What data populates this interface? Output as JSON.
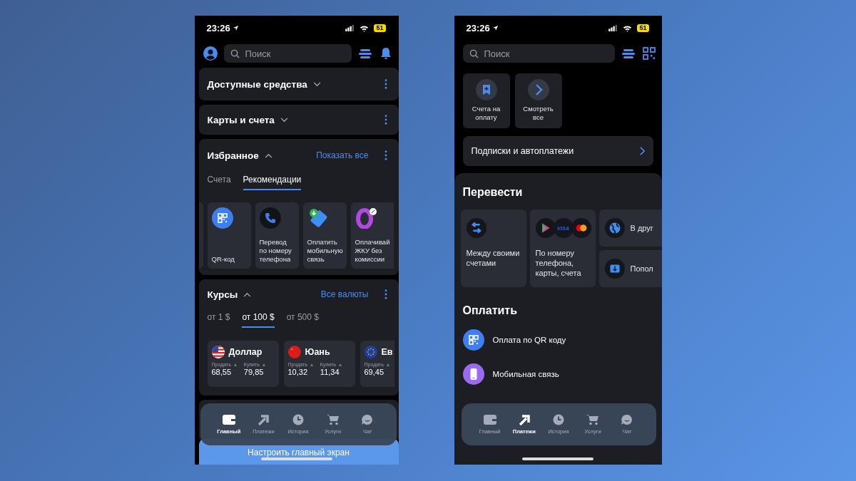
{
  "left_screen": {
    "status_bar": {
      "time": "23:26",
      "battery": "51"
    },
    "search": {
      "placeholder": "Поиск"
    },
    "sections": [
      {
        "title": "Доступные средства",
        "expanded": false
      },
      {
        "title": "Карты и счета",
        "expanded": false
      }
    ],
    "favorites": {
      "title": "Избранное",
      "expanded": true,
      "link": "Показать все",
      "tabs": [
        {
          "label": "Счета",
          "selected": false
        },
        {
          "label": "Рекомендации",
          "selected": true
        }
      ],
      "items": [
        {
          "kind": "qr",
          "label": "QR-код"
        },
        {
          "kind": "phone",
          "label": "Перевод по номеру телефона"
        },
        {
          "kind": "mobile",
          "label": "Оплатить мобильную связь"
        },
        {
          "kind": "zero",
          "label": "Оплачивай ЖКУ без комиссии"
        }
      ]
    },
    "rates": {
      "title": "Курсы",
      "expanded": true,
      "link": "Все валюты",
      "tabs": [
        {
          "label": "от 1 $",
          "selected": false
        },
        {
          "label": "от 100 $",
          "selected": true
        },
        {
          "label": "от 500 $",
          "selected": false
        }
      ],
      "cards": [
        {
          "kind": "us",
          "currency": "Доллар",
          "sell_label": "Продать",
          "sell": "68,55",
          "buy_label": "Купить",
          "buy": "79,85"
        },
        {
          "kind": "cn",
          "currency": "Юань",
          "sell_label": "Продать",
          "sell": "10,32",
          "buy_label": "Купить",
          "buy": "11,34"
        },
        {
          "kind": "eu",
          "currency": "Ев",
          "sell_label": "Продать",
          "sell": "69,45"
        }
      ]
    },
    "nav": [
      {
        "kind": "wallet",
        "label": "Главный",
        "selected": true
      },
      {
        "kind": "arrow",
        "label": "Платежи",
        "selected": false
      },
      {
        "kind": "clock",
        "label": "История",
        "selected": false
      },
      {
        "kind": "cart",
        "label": "Услуги",
        "selected": false
      },
      {
        "kind": "chat",
        "label": "Чат",
        "selected": false
      }
    ],
    "configure_button": "Настроить главный экран"
  },
  "right_screen": {
    "status_bar": {
      "time": "23:26",
      "battery": "51"
    },
    "search": {
      "placeholder": "Поиск"
    },
    "quick_tiles": [
      {
        "kind": "invoice",
        "label": "Счета на оплату"
      },
      {
        "kind": "chevron",
        "label": "Смотреть все"
      }
    ],
    "subscriptions": "Подписки и автоплатежи",
    "transfer": {
      "title": "Перевести",
      "tiles": [
        {
          "kind": "arrows",
          "label": "Между своими счетами"
        },
        {
          "kind": "logos",
          "logo_text": "VISA",
          "label": "По номеру телефона, карты, счета"
        },
        {
          "kind": "globe",
          "label": "В друг"
        },
        {
          "kind": "download",
          "label": "Попол"
        }
      ]
    },
    "pay": {
      "title": "Оплатить",
      "items": [
        {
          "kind": "qr",
          "color": "#3d7ff2",
          "label": "Оплата по QR коду"
        },
        {
          "kind": "phone",
          "color": "#9a6af0",
          "label": "Мобильная связь"
        }
      ]
    },
    "nav": [
      {
        "kind": "wallet",
        "label": "Главный",
        "selected": false
      },
      {
        "kind": "arrow",
        "label": "Платежи",
        "selected": true
      },
      {
        "kind": "clock",
        "label": "История",
        "selected": false
      },
      {
        "kind": "cart",
        "label": "Услуги",
        "selected": false
      },
      {
        "kind": "chat",
        "label": "Чат",
        "selected": false
      }
    ]
  }
}
